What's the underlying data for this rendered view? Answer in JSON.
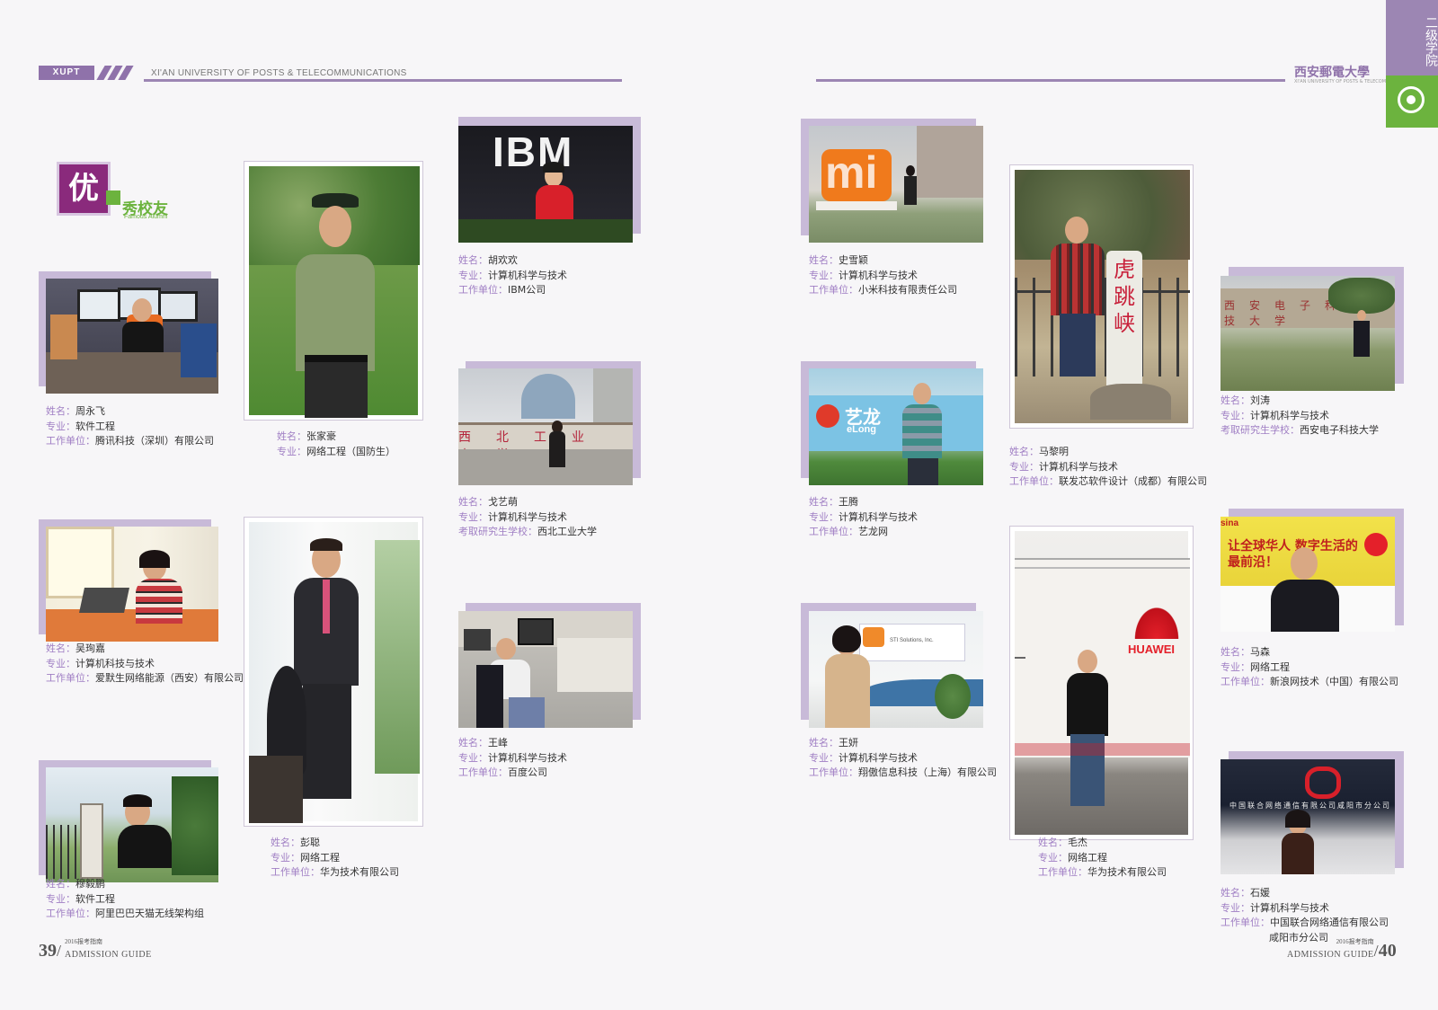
{
  "header": {
    "tag": "XUPT",
    "university_en": "XI'AN UNIVERSITY OF POSTS & TELECOMMUNICATIONS",
    "university_cn": "西安郵電大學",
    "university_cn_sub": "XI'AN UNIVERSITY OF POSTS & TELECOMMUNICATIONS",
    "side_tab": "二级学院"
  },
  "badge": {
    "char": "优",
    "title": "秀校友",
    "subtitle": "Famous Alumni"
  },
  "labels": {
    "name": "姓名：",
    "major": "专业：",
    "work": "工作单位：",
    "grad": "考取研究生学校："
  },
  "photo_text": {
    "ibm": "IBM",
    "mi": "mi",
    "huawei": "HUAWEI",
    "tiger": "虎跳峡",
    "elong": "艺龙",
    "elong_en": "eLong",
    "sina": "让全球华人 数字生活的最前沿！",
    "unicom": "中国联合网络通信有限公司咸阳市分公司",
    "sti": "STI Solutions, Inc."
  },
  "alumni": [
    {
      "name": "周永飞",
      "major": "软件工程",
      "work": "腾讯科技（深圳）有限公司"
    },
    {
      "name": "张家豪",
      "major": "网络工程（国防生）"
    },
    {
      "name": "胡欢欢",
      "major": "计算机科学与技术",
      "work": "IBM公司"
    },
    {
      "name": "戈艺萌",
      "major": "计算机科学与技术",
      "grad": "西北工业大学"
    },
    {
      "name": "王峰",
      "major": "计算机科学与技术",
      "work": "百度公司"
    },
    {
      "name": "吴珣嘉",
      "major": "计算机科技与技术",
      "work": "爱默生网络能源（西安）有限公司"
    },
    {
      "name": "彭聪",
      "major": "网络工程",
      "work": "华为技术有限公司"
    },
    {
      "name": "穆毅鹏",
      "major": "软件工程",
      "work": "阿里巴巴天猫无线架构组"
    },
    {
      "name": "史雪颖",
      "major": "计算机科学与技术",
      "work": "小米科技有限责任公司"
    },
    {
      "name": "王腾",
      "major": "计算机科学与技术",
      "work": "艺龙网"
    },
    {
      "name": "王妍",
      "major": "计算机科学与技术",
      "work": "翔傲信息科技（上海）有限公司"
    },
    {
      "name": "马黎明",
      "major": "计算机科学与技术",
      "work": "联发芯软件设计（成都）有限公司"
    },
    {
      "name": "毛杰",
      "major": "网络工程",
      "work": "华为技术有限公司"
    },
    {
      "name": "刘涛",
      "major": "计算机科学与技术",
      "grad": "西安电子科技大学"
    },
    {
      "name": "马森",
      "major": "网络工程",
      "work": "新浪网技术（中国）有限公司"
    },
    {
      "name": "石媛",
      "major": "计算机科学与技术",
      "work": "中国联合网络通信有限公司",
      "work2": "咸阳市分公司"
    }
  ],
  "footer": {
    "left_page": "39",
    "right_page": "40",
    "year_cn": "2016报考指南",
    "guide": "ADMISSION GUIDE"
  }
}
